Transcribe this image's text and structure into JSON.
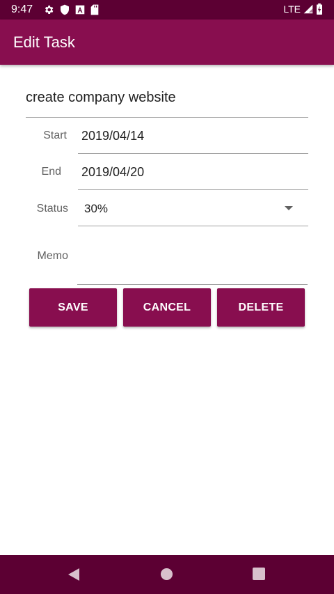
{
  "status_bar": {
    "time": "9:47",
    "network": "LTE",
    "icons": [
      "settings-icon",
      "shield-icon",
      "font-icon",
      "sd-card-icon",
      "signal-icon",
      "battery-charging-icon"
    ]
  },
  "app_bar": {
    "title": "Edit Task"
  },
  "form": {
    "task_name": "create company website",
    "start": {
      "label": "Start",
      "value": "2019/04/14"
    },
    "end": {
      "label": "End",
      "value": "2019/04/20"
    },
    "status": {
      "label": "Status",
      "value": "30%"
    },
    "memo": {
      "label": "Memo",
      "value": ""
    }
  },
  "buttons": {
    "save": "SAVE",
    "cancel": "CANCEL",
    "delete": "DELETE"
  },
  "colors": {
    "primary": "#880e4f",
    "primary_dark": "#5c0033"
  }
}
